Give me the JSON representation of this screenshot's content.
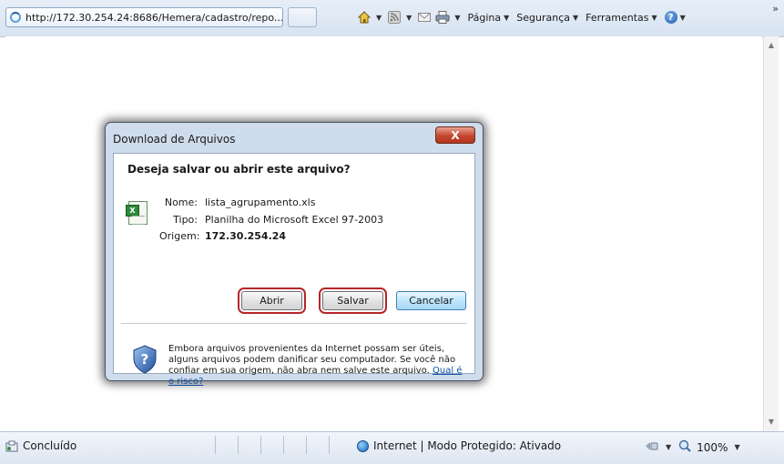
{
  "browser": {
    "tab_title": "http://172.30.254.24:8686/Hemera/cadastro/repo...",
    "command_bar": {
      "home_icon": "home-icon",
      "feeds_icon": "rss-feed-icon",
      "mail_icon": "mail-icon",
      "print_icon": "printer-icon",
      "page_label": "Página",
      "security_label": "Segurança",
      "tools_label": "Ferramentas",
      "help_icon": "help-icon",
      "help_glyph": "?",
      "more_chevrons": "»"
    }
  },
  "dialog": {
    "title": "Download de Arquivos",
    "close_glyph": "X",
    "question": "Deseja salvar ou abrir este arquivo?",
    "file_icon_glyph": "X",
    "fields": [
      {
        "label": "Nome:",
        "value": "lista_agrupamento.xls"
      },
      {
        "label": "Tipo:",
        "value": "Planilha do Microsoft Excel 97-2003"
      },
      {
        "label": "Origem:",
        "value": "172.30.254.24"
      }
    ],
    "buttons": {
      "open": "Abrir",
      "save": "Salvar",
      "cancel": "Cancelar"
    },
    "warning_text": "Embora arquivos provenientes da Internet possam ser úteis, alguns arquivos podem danificar seu computador. Se você não confiar em sua origem, não abra nem salve este arquivo.",
    "risk_link": "Qual é o risco?"
  },
  "statusbar": {
    "status": "Concluído",
    "zone": "Internet | Modo Protegido: Ativado",
    "zoom": "100%"
  },
  "colors": {
    "highlight_outline": "#b5262a",
    "close_button": "#c2472e",
    "link": "#0a50a8"
  }
}
